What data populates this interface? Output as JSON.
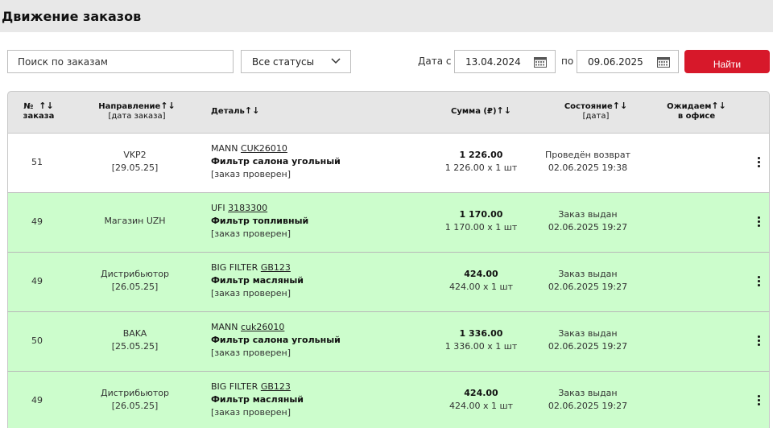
{
  "page": {
    "title": "Движение заказов"
  },
  "filters": {
    "search_placeholder": "Поиск по заказам",
    "status_selected": "Все статусы",
    "date_from_label": "Дата с",
    "date_from": "13.04.2024",
    "date_to_label": "по",
    "date_to": "09.06.2025",
    "find_label": "Найти"
  },
  "table": {
    "headers": {
      "num": [
        "№",
        "заказа"
      ],
      "direction": [
        "Направление",
        "[дата заказа]"
      ],
      "detail": "Деталь",
      "sum": "Сумма (₽)",
      "state": [
        "Состояние",
        "[дата]"
      ],
      "waiting": [
        "Ожидаем",
        "в офисе"
      ],
      "sort_icon": "↑↓"
    },
    "rows": [
      {
        "num": "51",
        "direction": "VKP2",
        "direction_date": "[29.05.25]",
        "brand": "MANN",
        "code": "CUK26010",
        "name": "Фильтр салона угольный",
        "note": "[заказ проверен]",
        "total": "1 226.00",
        "qty": "1 226.00 x 1 шт",
        "state": "Проведён возврат",
        "state_date": "02.06.2025 19:38",
        "highlight": "white"
      },
      {
        "num": "49",
        "direction": "Магазин UZH",
        "direction_date": "",
        "brand": "UFI",
        "code": "3183300",
        "name": "Фильтр топливный",
        "note": "[заказ проверен]",
        "total": "1 170.00",
        "qty": "1 170.00 x 1 шт",
        "state": "Заказ выдан",
        "state_date": "02.06.2025 19:27",
        "highlight": "green"
      },
      {
        "num": "49",
        "direction": "Дистрибьютор",
        "direction_date": "[26.05.25]",
        "brand": "BIG FILTER",
        "code": "GB123",
        "name": "Фильтр масляный",
        "note": "[заказ проверен]",
        "total": "424.00",
        "qty": "424.00 x 1 шт",
        "state": "Заказ выдан",
        "state_date": "02.06.2025 19:27",
        "highlight": "green"
      },
      {
        "num": "50",
        "direction": "BAKA",
        "direction_date": "[25.05.25]",
        "brand": "MANN",
        "code": "cuk26010",
        "name": "Фильтр салона угольный",
        "note": "[заказ проверен]",
        "total": "1 336.00",
        "qty": "1 336.00 x 1 шт",
        "state": "Заказ выдан",
        "state_date": "02.06.2025 19:27",
        "highlight": "green"
      },
      {
        "num": "49",
        "direction": "Дистрибьютор",
        "direction_date": "[26.05.25]",
        "brand": "BIG FILTER",
        "code": "GB123",
        "name": "Фильтр масляный",
        "note": "[заказ проверен]",
        "total": "424.00",
        "qty": "424.00 x 1 шт",
        "state": "Заказ выдан",
        "state_date": "02.06.2025 19:27",
        "highlight": "green"
      }
    ]
  },
  "colors": {
    "accent": "#d7182a",
    "row_highlight": "#ccfdcc",
    "header_bg": "#e6e6e6"
  },
  "icons": {
    "status_dropdown": "chevron-down-icon",
    "date_picker": "calendar-icon",
    "row_menu": "kebab-menu-icon"
  }
}
